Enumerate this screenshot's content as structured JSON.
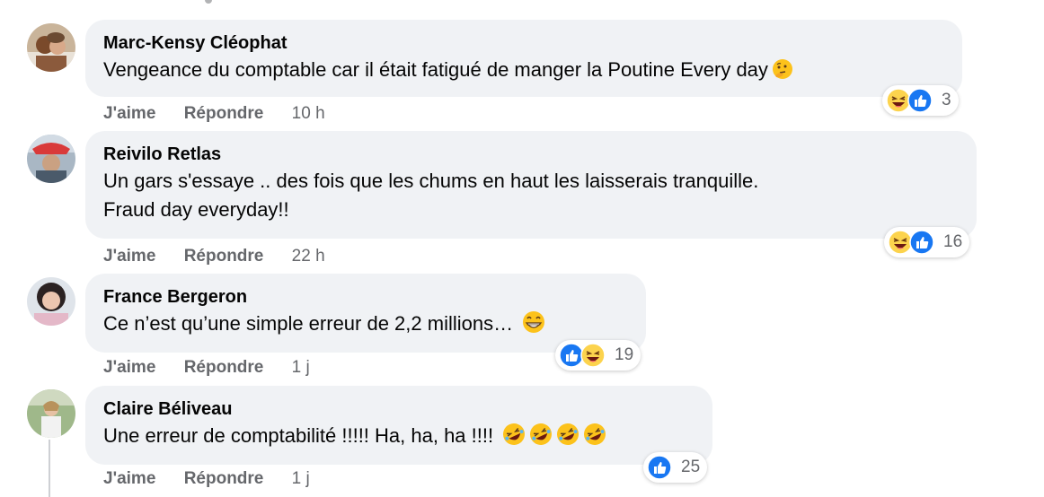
{
  "comments": [
    {
      "author": "Marc-Kensy Cléophat",
      "text_lines": [
        "Vengeance du comptable car il était fatigué de manger la Poutine Every day"
      ],
      "trailing_emoji": [
        "thinking-face"
      ],
      "actions": {
        "like": "J'aime",
        "reply": "Répondre",
        "time": "10 h"
      },
      "reactions": {
        "icons": [
          "haha",
          "like"
        ],
        "count": "3"
      }
    },
    {
      "author": "Reivilo Retlas",
      "text_lines": [
        "Un gars s'essaye .. des fois que les chums en haut les laisserais tranquille.",
        "Fraud day everyday!!"
      ],
      "trailing_emoji": [],
      "actions": {
        "like": "J'aime",
        "reply": "Répondre",
        "time": "22 h"
      },
      "reactions": {
        "icons": [
          "haha",
          "like"
        ],
        "count": "16"
      }
    },
    {
      "author": "France Bergeron",
      "text_lines": [
        "Ce n’est qu’une simple erreur de 2,2 millions… "
      ],
      "trailing_emoji": [
        "grinning-face"
      ],
      "actions": {
        "like": "J'aime",
        "reply": "Répondre",
        "time": "1 j"
      },
      "reactions": {
        "icons": [
          "like",
          "haha"
        ],
        "count": "19"
      }
    },
    {
      "author": "Claire Béliveau",
      "text_lines": [
        "Une erreur de comptabilité !!!!! Ha, ha, ha !!!! "
      ],
      "trailing_emoji": [
        "rofl",
        "rofl",
        "rofl",
        "rofl"
      ],
      "actions": {
        "like": "J'aime",
        "reply": "Répondre",
        "time": "1 j"
      },
      "reactions": {
        "icons": [
          "like"
        ],
        "count": "25"
      }
    }
  ],
  "colors": {
    "bubble": "#f0f2f5",
    "meta_text": "#65676b",
    "like_blue": "#1877f2",
    "haha_yellow": "#fcd34d"
  }
}
